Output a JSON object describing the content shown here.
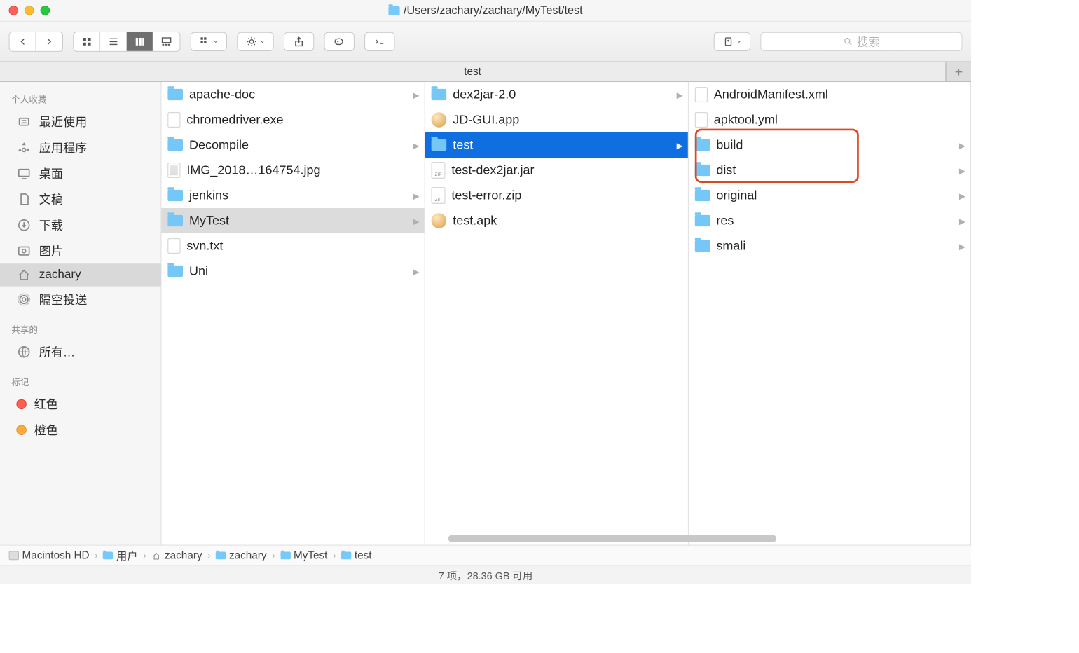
{
  "window": {
    "path": "/Users/zachary/zachary/MyTest/test"
  },
  "toolbar": {
    "search_placeholder": "搜索"
  },
  "tab": {
    "label": "test"
  },
  "sidebar": {
    "favorites_header": "个人收藏",
    "favorites": [
      {
        "label": "最近使用",
        "icon": "recents"
      },
      {
        "label": "应用程序",
        "icon": "apps"
      },
      {
        "label": "桌面",
        "icon": "desktop"
      },
      {
        "label": "文稿",
        "icon": "documents"
      },
      {
        "label": "下载",
        "icon": "downloads"
      },
      {
        "label": "图片",
        "icon": "pictures"
      },
      {
        "label": "zachary",
        "icon": "home",
        "selected": true
      },
      {
        "label": "隔空投送",
        "icon": "airdrop"
      }
    ],
    "shared_header": "共享的",
    "shared": [
      {
        "label": "所有…",
        "icon": "network"
      }
    ],
    "tags_header": "标记",
    "tags": [
      {
        "label": "红色",
        "color": "red"
      },
      {
        "label": "橙色",
        "color": "orange"
      }
    ]
  },
  "columns": {
    "col1": [
      {
        "name": "apache-doc",
        "type": "folder",
        "hasChildren": true
      },
      {
        "name": "chromedriver.exe",
        "type": "file"
      },
      {
        "name": "Decompile",
        "type": "folder",
        "hasChildren": true
      },
      {
        "name": "IMG_2018…164754.jpg",
        "type": "image"
      },
      {
        "name": "jenkins",
        "type": "folder",
        "hasChildren": true
      },
      {
        "name": "MyTest",
        "type": "folder",
        "hasChildren": true,
        "selected": "path"
      },
      {
        "name": "svn.txt",
        "type": "file"
      },
      {
        "name": "Uni",
        "type": "folder",
        "hasChildren": true
      }
    ],
    "col2": [
      {
        "name": "dex2jar-2.0",
        "type": "folder",
        "hasChildren": true
      },
      {
        "name": "JD-GUI.app",
        "type": "app"
      },
      {
        "name": "test",
        "type": "folder",
        "hasChildren": true,
        "selected": "active"
      },
      {
        "name": "test-dex2jar.jar",
        "type": "zip"
      },
      {
        "name": "test-error.zip",
        "type": "zip"
      },
      {
        "name": "test.apk",
        "type": "app"
      }
    ],
    "col3": [
      {
        "name": "AndroidManifest.xml",
        "type": "file"
      },
      {
        "name": "apktool.yml",
        "type": "file"
      },
      {
        "name": "build",
        "type": "folder",
        "hasChildren": true,
        "highlighted": true
      },
      {
        "name": "dist",
        "type": "folder",
        "hasChildren": true,
        "highlighted": true
      },
      {
        "name": "original",
        "type": "folder",
        "hasChildren": true
      },
      {
        "name": "res",
        "type": "folder",
        "hasChildren": true
      },
      {
        "name": "smali",
        "type": "folder",
        "hasChildren": true
      }
    ]
  },
  "pathbar": [
    {
      "label": "Macintosh HD",
      "icon": "hd"
    },
    {
      "label": "用户",
      "icon": "folder"
    },
    {
      "label": "zachary",
      "icon": "home"
    },
    {
      "label": "zachary",
      "icon": "folder"
    },
    {
      "label": "MyTest",
      "icon": "folder"
    },
    {
      "label": "test",
      "icon": "folder"
    }
  ],
  "status": {
    "text": "7 项，28.36 GB 可用"
  }
}
